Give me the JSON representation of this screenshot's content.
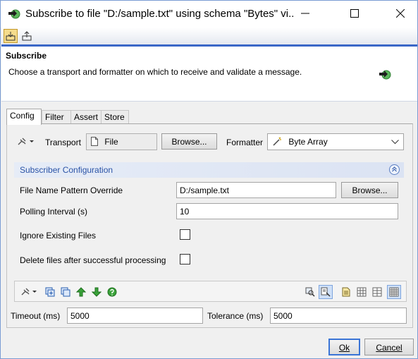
{
  "window": {
    "title": "Subscribe to file \"D:/sample.txt\" using schema \"Bytes\" vi..."
  },
  "header": {
    "title": "Subscribe",
    "description": "Choose a transport and formatter on which to receive and validate a message."
  },
  "tabs": [
    {
      "label": "Config",
      "selected": true
    },
    {
      "label": "Filter",
      "selected": false
    },
    {
      "label": "Assert",
      "selected": false
    },
    {
      "label": "Store",
      "selected": false
    }
  ],
  "transport": {
    "label": "Transport",
    "value": "File",
    "browse_label": "Browse..."
  },
  "formatter": {
    "label": "Formatter",
    "value": "Byte Array"
  },
  "subscriber_config": {
    "section_title": "Subscriber Configuration",
    "file_pattern_label": "File Name Pattern Override",
    "file_pattern_value": "D:/sample.txt",
    "file_browse_label": "Browse...",
    "polling_label": "Polling Interval (s)",
    "polling_value": "10",
    "ignore_existing_label": "Ignore Existing Files",
    "ignore_existing_checked": false,
    "delete_after_label": "Delete files after successful processing",
    "delete_after_checked": false
  },
  "timeout": {
    "label": "Timeout (ms)",
    "value": "5000"
  },
  "tolerance": {
    "label": "Tolerance (ms)",
    "value": "5000"
  },
  "dialog_buttons": {
    "ok_label": "Ok",
    "cancel_label": "Cancel"
  },
  "colors": {
    "accent_blue": "#3b67c7",
    "section_text": "#2a53a6",
    "green_icon": "#3aa23a"
  }
}
